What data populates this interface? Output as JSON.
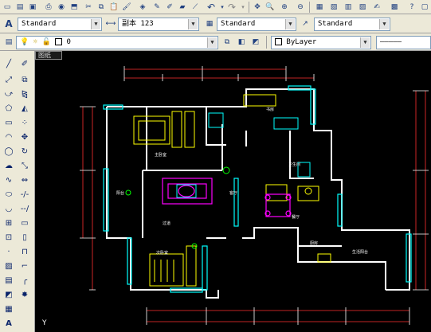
{
  "toolbar_row2": {
    "text_style": "Standard",
    "dim_style": "副本 123",
    "table_style": "Standard",
    "multileader_style": "Standard"
  },
  "toolbar_row3": {
    "layer": "0",
    "color": "ByLayer",
    "linetype_label": "—————"
  },
  "canvas": {
    "tab_label": "图纸",
    "ucs_label": "Y",
    "room_labels": {
      "master_bedroom": "主卧室",
      "study": "书房",
      "living": "客厅",
      "dining": "餐厅",
      "balcony": "阳台",
      "child_room": "次卧室",
      "kitchen": "厨房",
      "bath": "卫生间",
      "balcony2": "生活阳台",
      "corridor": "过道"
    },
    "colors": {
      "walls": "#ffffff",
      "cyan": "#00ffff",
      "yellow": "#ffff00",
      "magenta": "#ff00ff",
      "red": "#ff0000",
      "green": "#00ff00"
    }
  }
}
